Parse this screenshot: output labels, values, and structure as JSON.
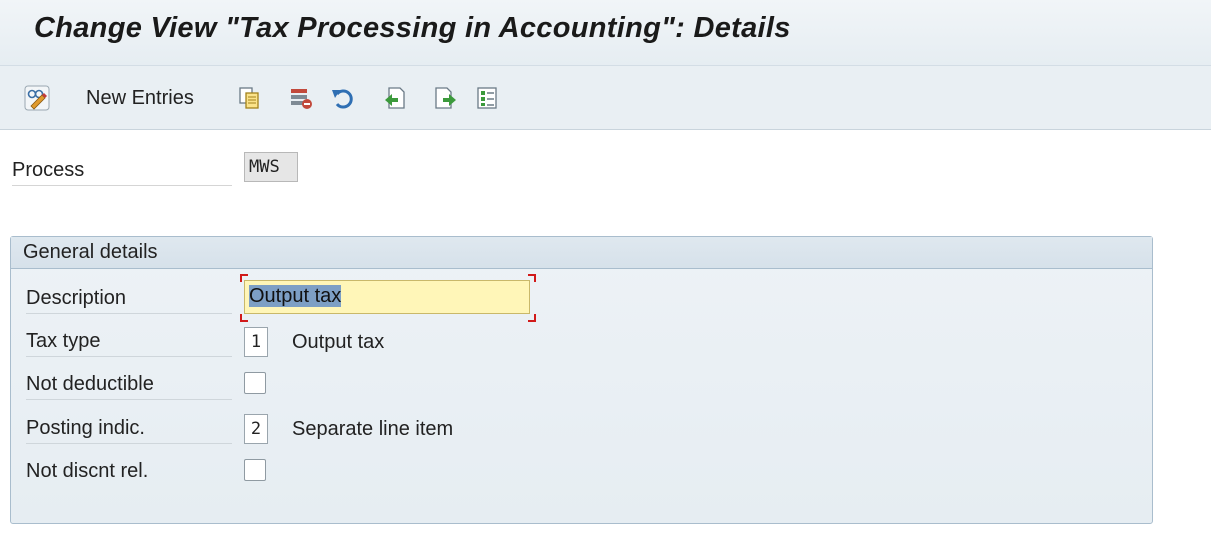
{
  "window": {
    "title": "Change View \"Tax Processing in Accounting\": Details"
  },
  "toolbar": {
    "new_entries_label": "New Entries",
    "icons": [
      "display-change-icon",
      "copy-icon",
      "delete-icon",
      "undo-icon",
      "previous-entry-icon",
      "next-entry-icon",
      "select-all-icon"
    ]
  },
  "process": {
    "label": "Process",
    "value": "MWS"
  },
  "general_details": {
    "header": "General details",
    "description": {
      "label": "Description",
      "value": "Output tax"
    },
    "tax_type": {
      "label": "Tax type",
      "code": "1",
      "text": "Output tax"
    },
    "not_deductible": {
      "label": "Not deductible",
      "checked": false
    },
    "posting_indic": {
      "label": "Posting indic.",
      "code": "2",
      "text": "Separate line item"
    },
    "not_discnt_rel": {
      "label": "Not discnt rel.",
      "checked": false
    }
  },
  "colors": {
    "focus_bg": "#fff6b8",
    "selection": "#7d9fc5",
    "focus_corner": "#d11a1a",
    "group_border": "#a9bdcd"
  }
}
